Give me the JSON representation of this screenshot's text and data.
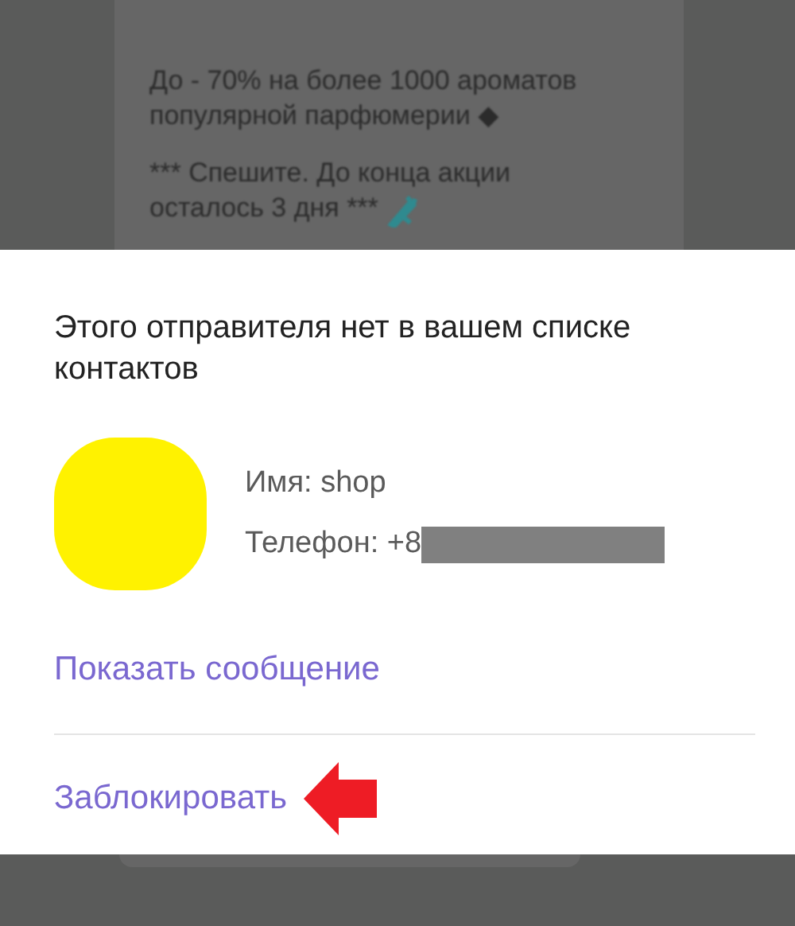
{
  "background_message": {
    "paragraphs": [
      "До - 70% на более 1000 ароматов популярной парфюмерии ◆",
      "*** Спешите. До конца акции осталось 3 дня ***"
    ]
  },
  "dialog": {
    "title": "Этого отправителя нет в вашем списке контактов",
    "sender": {
      "name": "Имя: shop",
      "phone": "Телефон: +8"
    },
    "actions": [
      {
        "label": "Показать сообщение",
        "highlighted": false
      },
      {
        "label": "Заблокировать",
        "highlighted": true
      }
    ]
  }
}
